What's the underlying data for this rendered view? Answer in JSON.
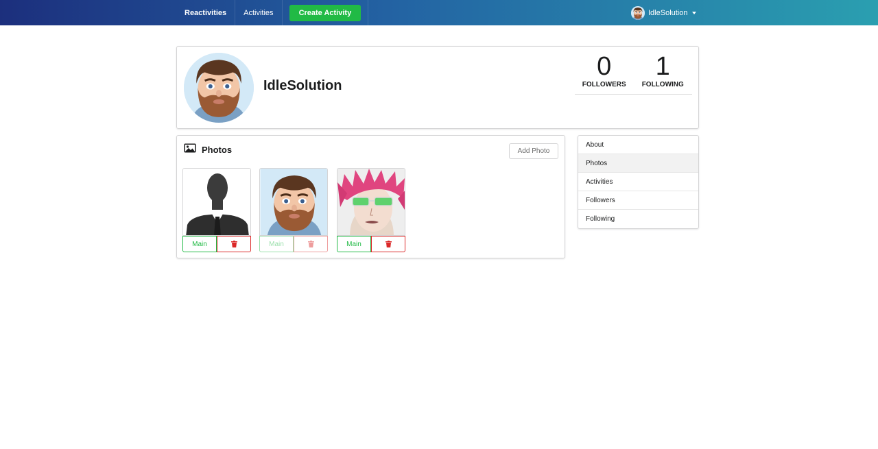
{
  "nav": {
    "brand": "Reactivities",
    "activities": "Activities",
    "create_activity": "Create Activity",
    "username": "IdleSolution"
  },
  "profile": {
    "display_name": "IdleSolution",
    "followers_count": "0",
    "followers_label": "FOLLOWERS",
    "following_count": "1",
    "following_label": "FOLLOWING"
  },
  "photos": {
    "title": "Photos",
    "add_photo": "Add Photo",
    "items": [
      {
        "image": "business-silhouette",
        "main_label": "Main",
        "is_main": false
      },
      {
        "image": "bearded-man-avatar",
        "main_label": "Main",
        "is_main": true
      },
      {
        "image": "pink-hair-anime-character",
        "main_label": "Main",
        "is_main": false
      }
    ]
  },
  "sidebar": {
    "items": [
      {
        "label": "About"
      },
      {
        "label": "Photos",
        "active": true
      },
      {
        "label": "Activities"
      },
      {
        "label": "Followers"
      },
      {
        "label": "Following"
      }
    ]
  },
  "colors": {
    "accent_green": "#21ba45",
    "danger_red": "#db2828",
    "nav_gradient_start": "#1c2f7d",
    "nav_gradient_end": "#2a9fb0"
  }
}
